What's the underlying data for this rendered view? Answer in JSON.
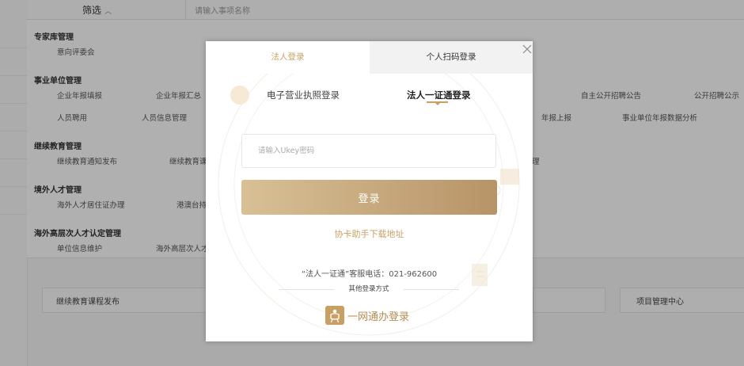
{
  "background": {
    "filter_label": "筛选",
    "search_placeholder": "请输入事项名称",
    "categories": [
      {
        "title": "专家库管理",
        "items": [
          "意向评委会"
        ]
      },
      {
        "title": "事业单位管理",
        "items": [
          "企业年报填报",
          "企业年报汇总",
          "自主公开招聘公告",
          "公开招聘公示",
          "人员聘用",
          "人员信息管理",
          "年报上报",
          "事业单位年报数据分析"
        ]
      },
      {
        "title": "继续教育管理",
        "items": [
          "继续教育通知发布",
          "继续教育课",
          "理"
        ]
      },
      {
        "title": "境外人才管理",
        "items": [
          "海外人才居住证办理",
          "港澳台持"
        ]
      },
      {
        "title": "海外高层次人才认定管理",
        "items": [
          "单位信息维护",
          "海外高层次人才"
        ]
      }
    ],
    "bottom_items": [
      "继续教育课程发布",
      "项目管理中心"
    ]
  },
  "modal": {
    "tabs": [
      "法人登录",
      "个人扫码登录"
    ],
    "sub_tabs": [
      "电子营业执照登录",
      "法人一证通登录"
    ],
    "ukey_placeholder": "请输入Ukey密码",
    "login_label": "登录",
    "download_link": "协卡助手下载地址",
    "hotline": "“法人一证通”客服电话：021-962600",
    "other_methods": "其他登录方式",
    "yiwang_label": "一网通办登录",
    "accent": "#c8a064"
  }
}
